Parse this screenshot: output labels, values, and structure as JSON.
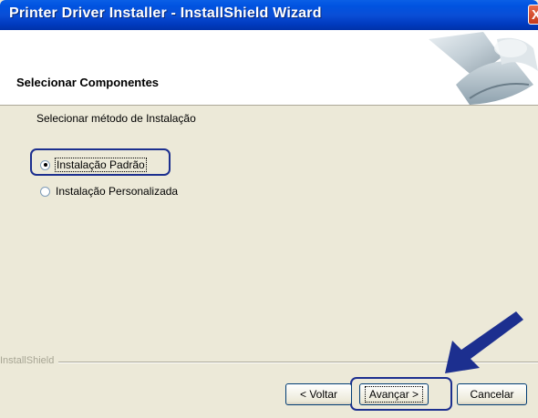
{
  "window": {
    "title": "Printer Driver Installer - InstallShield Wizard",
    "close_glyph": "X"
  },
  "header": {
    "title": "Selecionar Componentes"
  },
  "body": {
    "prompt": "Selecionar método de Instalação",
    "options": [
      {
        "label": "Instalação Padrão",
        "selected": true
      },
      {
        "label": "Instalação Personalizada",
        "selected": false
      }
    ]
  },
  "footer": {
    "brand": "InstallShield",
    "back_label": "< Voltar",
    "next_label": "Avançar >",
    "cancel_label": "Cancelar"
  },
  "colors": {
    "titlebar": "#0a4ed6",
    "callout": "#1c2f8f",
    "dialog_bg": "#ece9d8"
  },
  "icons": {
    "header_graphic": "computer-cd-graphic",
    "callout_arrow": "arrow-pointer-icon"
  }
}
